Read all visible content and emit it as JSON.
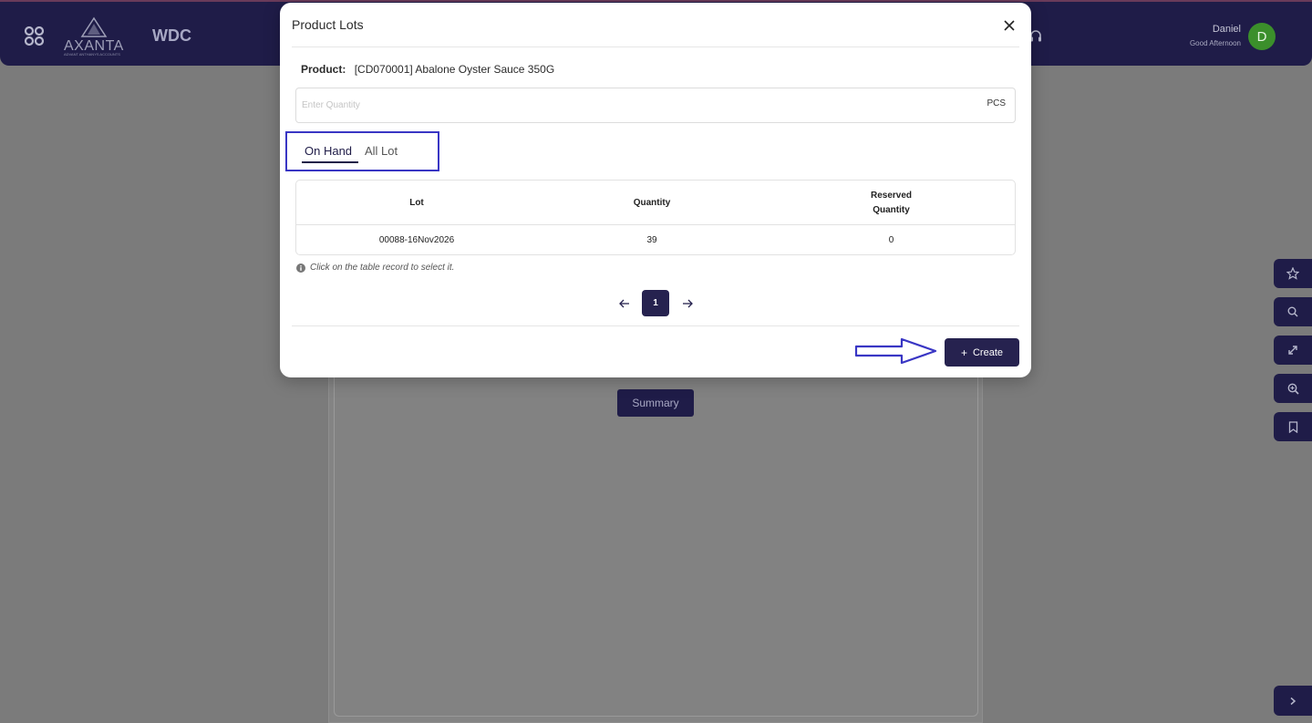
{
  "header": {
    "logo_text": "AXANTA",
    "logo_subtitle": "ADVANT ANTHANYS ACCOUNTS",
    "brand": "WDC",
    "user_name": "Daniel",
    "greeting": "Good Afternoon",
    "avatar_initial": "D",
    "avatar_color": "#3b8f2b"
  },
  "background": {
    "summary_label": "Summary"
  },
  "modal": {
    "title": "Product Lots",
    "product_label": "Product:",
    "product_value": "[CD070001] Abalone Oyster Sauce 350G",
    "quantity_placeholder": "Enter Quantity",
    "quantity_value": "",
    "quantity_unit": "PCS",
    "tabs": [
      {
        "label": "On Hand",
        "active": true
      },
      {
        "label": "All Lot",
        "active": false
      }
    ],
    "table": {
      "headers": [
        "Lot",
        "Quantity",
        "Reserved Quantity"
      ],
      "rows": [
        {
          "lot": "00088-16Nov2026",
          "quantity": "39",
          "reserved": "0"
        }
      ]
    },
    "hint": "Click on the table record to select it.",
    "pagination": {
      "current_page": "1"
    },
    "create_label": "Create"
  },
  "icons": {
    "apps": "apps-grid-icon",
    "headset": "headset-icon",
    "close": "close-icon",
    "info": "info-icon",
    "prev": "arrow-left-icon",
    "next": "arrow-right-icon",
    "plus": "plus-icon",
    "side_tools": [
      "star-icon",
      "search-icon",
      "expand-icon",
      "zoom-in-icon",
      "bookmark-icon"
    ],
    "side_expand": "chevron-right-icon"
  },
  "colors": {
    "primary": "#26224f",
    "annotation": "#3936c4",
    "overlay": "#7b7b7b"
  }
}
